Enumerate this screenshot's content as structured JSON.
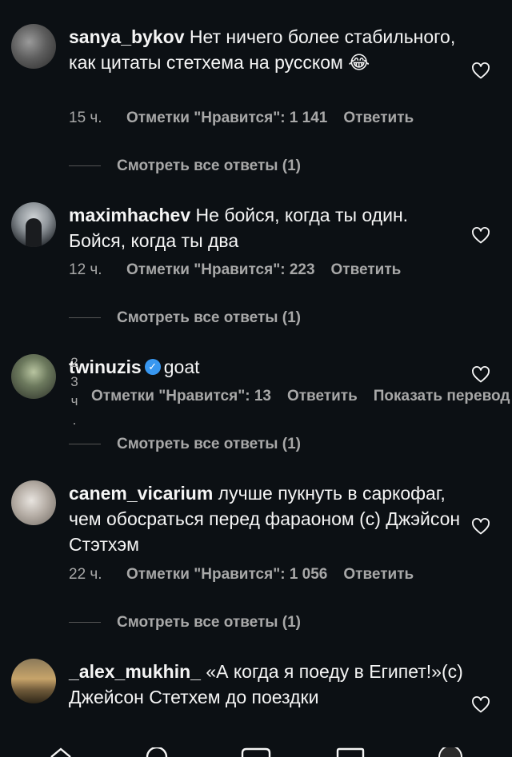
{
  "comments": [
    {
      "username": "sanya_bykov",
      "text": "Нет ничего более стабильного, как цитаты стетхема на русском 😂",
      "time": "15 ч.",
      "likes": "Отметки \"Нравится\": 1 141",
      "reply": "Ответить",
      "view_replies": "Смотреть все ответы (1)"
    },
    {
      "username": "maximhachev",
      "text": "Не бойся, когда ты один. Бойся, когда ты два",
      "time": "12 ч.",
      "likes": "Отметки \"Нравится\": 223",
      "reply": "Ответить",
      "view_replies": "Смотреть все ответы (1)"
    },
    {
      "username": "twinuzis",
      "verified": true,
      "text": "goat",
      "time_stack": [
        "2",
        "3",
        "ч",
        "."
      ],
      "likes": "Отметки \"Нравится\": 13",
      "reply": "Ответить",
      "translate": "Показать перевод",
      "view_replies": "Смотреть все ответы (1)"
    },
    {
      "username": "canem_vicarium",
      "text": "лучше пукнуть в саркофаг, чем обосраться перед фараоном (с) Джэйсон Стэтхэм",
      "time": "22 ч.",
      "likes": "Отметки \"Нравится\": 1 056",
      "reply": "Ответить",
      "view_replies": "Смотреть все ответы (1)"
    },
    {
      "username": "_alex_mukhin_",
      "text": "«А когда я поеду в Египет!»(с) Джейсон Стетхем до поездки"
    }
  ],
  "icons": {
    "like": "heart-outline-icon",
    "verified": "verified-badge-icon",
    "nav": [
      "home-icon",
      "search-icon",
      "reels-icon",
      "shop-icon",
      "profile-icon"
    ]
  },
  "colors": {
    "background": "#0c1014",
    "text": "#f5f5f5",
    "secondary": "#a8a8a8",
    "verified": "#3897f0"
  }
}
